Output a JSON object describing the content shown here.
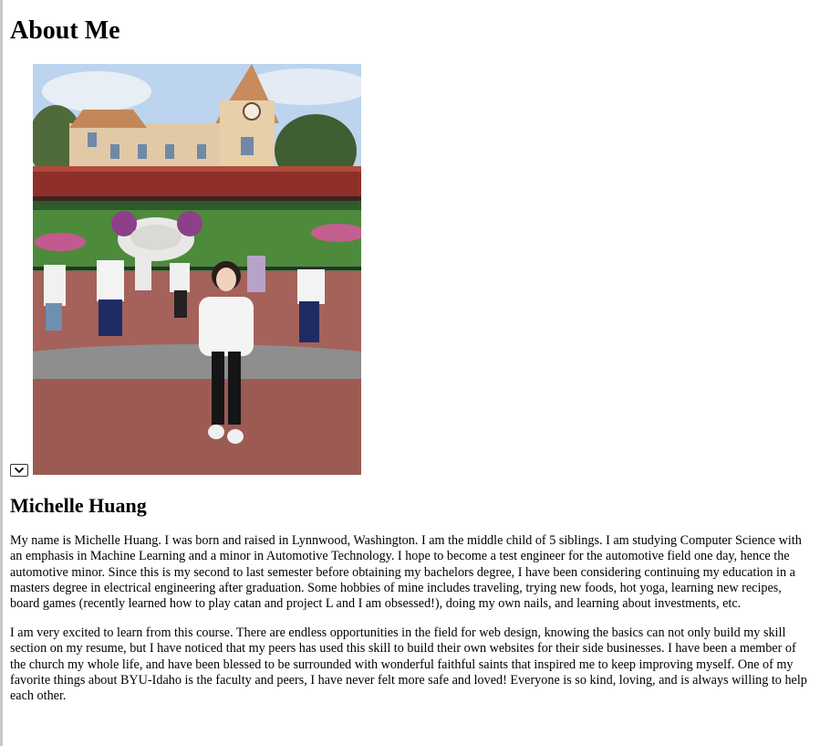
{
  "page": {
    "heading": "About Me",
    "name": "Michelle Huang",
    "paragraphs": [
      "My name is Michelle Huang. I was born and raised in Lynnwood, Washington. I am the middle child of 5 siblings. I am studying Computer Science with an emphasis in Machine Learning and a minor in Automotive Technology. I hope to become a test engineer for the automotive field one day, hence the automotive minor. Since this is my second to last semester before obtaining my bachelors degree, I have been considering continuing my education in a masters degree in electrical engineering after graduation. Some hobbies of mine includes traveling, trying new foods, hot yoga, learning new recipes, board games (recently learned how to play catan and project L and I am obsessed!), doing my own nails, and learning about investments, etc.",
      "I am very excited to learn from this course. There are endless opportunities in the field for web design, knowing the basics can not only build my skill section on my resume, but I have noticed that my peers has used this skill to build their own websites for their side businesses. I have been a member of the church my whole life, and have been blessed to be surrounded with wonderful faithful saints that inspired me to keep improving myself. One of my favorite things about BYU-Idaho is the faculty and peers, I have never felt more safe and loved! Everyone is so kind, loving, and is always willing to help each other."
    ]
  },
  "icons": {
    "dropdown": "chevron-down-icon"
  },
  "colors": {
    "sky": "#b9d3ee",
    "station_roof": "#c98a5c",
    "brick": "#9c5b52",
    "lawn": "#4d8a3c",
    "train_red": "#8e2f2a"
  }
}
